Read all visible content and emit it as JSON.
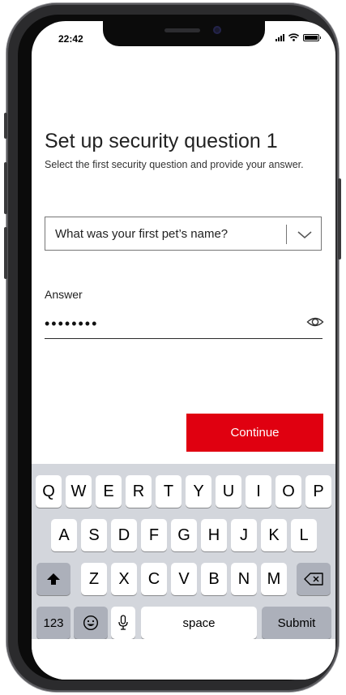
{
  "status_bar": {
    "time": "22:42"
  },
  "page": {
    "title": "Set up security question 1",
    "subtitle": "Select the first security question and provide your answer."
  },
  "security_question": {
    "selected": "What was your first pet’s name?"
  },
  "answer": {
    "label": "Answer",
    "value": "••••••••"
  },
  "continue_label": "Continue",
  "keyboard": {
    "row1": [
      "Q",
      "W",
      "E",
      "R",
      "T",
      "Y",
      "U",
      "I",
      "O",
      "P"
    ],
    "row2": [
      "A",
      "S",
      "D",
      "F",
      "G",
      "H",
      "J",
      "K",
      "L"
    ],
    "row3": [
      "Z",
      "X",
      "C",
      "V",
      "B",
      "N",
      "M"
    ],
    "numbers_label": "123",
    "space_label": "space",
    "submit_label": "Submit"
  },
  "colors": {
    "accent": "#e00010",
    "keyboard_bg": "#d3d6dc"
  }
}
